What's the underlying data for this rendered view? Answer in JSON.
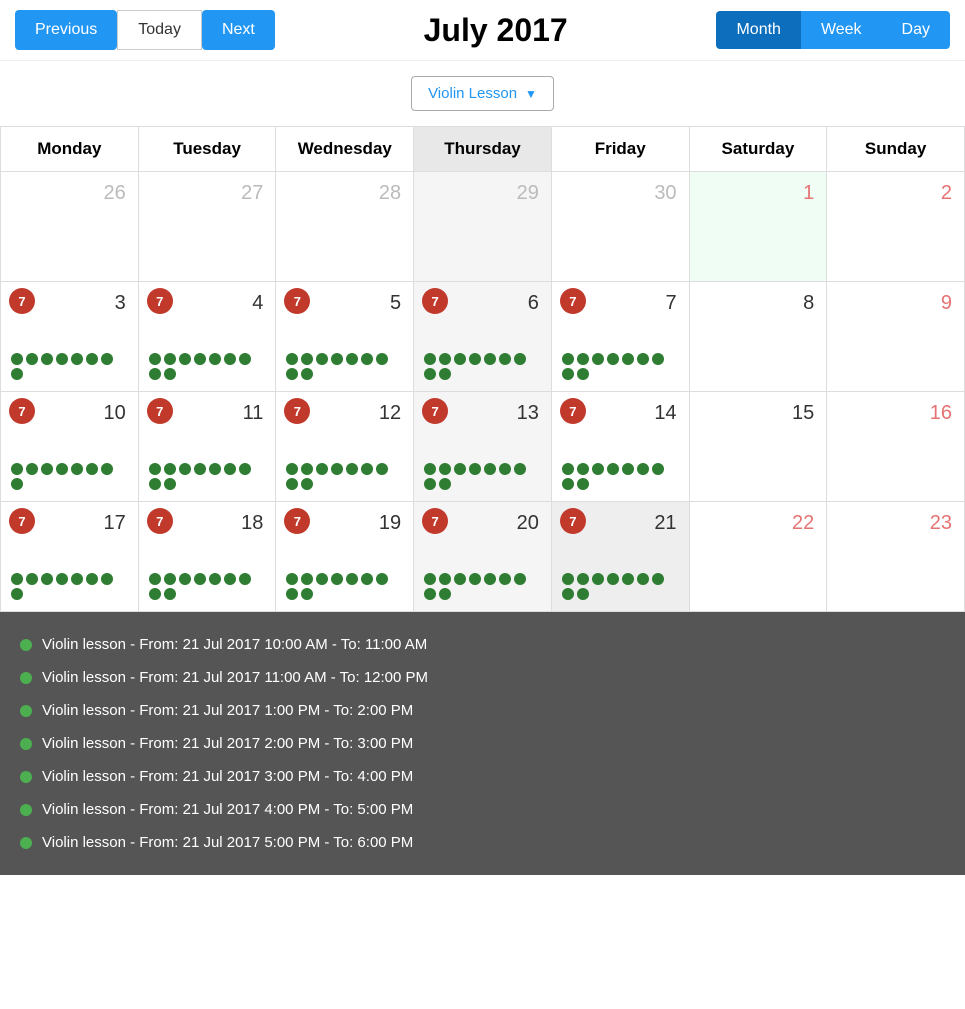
{
  "header": {
    "title": "July 2017",
    "prev_label": "Previous",
    "today_label": "Today",
    "next_label": "Next",
    "view_month": "Month",
    "view_week": "Week",
    "view_day": "Day"
  },
  "filter": {
    "label": "Violin Lesson",
    "arrow": "▼"
  },
  "days_of_week": [
    {
      "label": "Monday",
      "active": false
    },
    {
      "label": "Tuesday",
      "active": false
    },
    {
      "label": "Wednesday",
      "active": false
    },
    {
      "label": "Thursday",
      "active": true
    },
    {
      "label": "Friday",
      "active": false
    },
    {
      "label": "Saturday",
      "active": false
    },
    {
      "label": "Sunday",
      "active": false
    }
  ],
  "weeks": [
    {
      "days": [
        {
          "num": "26",
          "muted": true,
          "badge": null,
          "dots": 0,
          "today": false,
          "weekend": false,
          "selected": false
        },
        {
          "num": "27",
          "muted": true,
          "badge": null,
          "dots": 0,
          "today": false,
          "weekend": false,
          "selected": false
        },
        {
          "num": "28",
          "muted": true,
          "badge": null,
          "dots": 0,
          "today": false,
          "weekend": false,
          "selected": false
        },
        {
          "num": "29",
          "muted": true,
          "badge": null,
          "dots": 0,
          "today": false,
          "weekend": false,
          "selected": false
        },
        {
          "num": "30",
          "muted": true,
          "badge": null,
          "dots": 0,
          "today": false,
          "weekend": false,
          "selected": false
        },
        {
          "num": "1",
          "muted": false,
          "badge": null,
          "dots": 0,
          "today": true,
          "weekend": false,
          "selected": false
        },
        {
          "num": "2",
          "muted": false,
          "badge": null,
          "dots": 0,
          "today": false,
          "weekend": true,
          "selected": false
        }
      ]
    },
    {
      "days": [
        {
          "num": "3",
          "muted": false,
          "badge": "7",
          "dots": 8,
          "today": false,
          "weekend": false,
          "selected": false
        },
        {
          "num": "4",
          "muted": false,
          "badge": "7",
          "dots": 9,
          "today": false,
          "weekend": false,
          "selected": false
        },
        {
          "num": "5",
          "muted": false,
          "badge": "7",
          "dots": 9,
          "today": false,
          "weekend": false,
          "selected": false
        },
        {
          "num": "6",
          "muted": false,
          "badge": "7",
          "dots": 9,
          "today": false,
          "weekend": false,
          "selected": false
        },
        {
          "num": "7",
          "muted": false,
          "badge": "7",
          "dots": 9,
          "today": false,
          "weekend": false,
          "selected": false
        },
        {
          "num": "8",
          "muted": false,
          "badge": null,
          "dots": 0,
          "today": false,
          "weekend": false,
          "selected": false
        },
        {
          "num": "9",
          "muted": false,
          "badge": null,
          "dots": 0,
          "today": false,
          "weekend": true,
          "selected": false
        }
      ]
    },
    {
      "days": [
        {
          "num": "10",
          "muted": false,
          "badge": "7",
          "dots": 8,
          "today": false,
          "weekend": false,
          "selected": false
        },
        {
          "num": "11",
          "muted": false,
          "badge": "7",
          "dots": 9,
          "today": false,
          "weekend": false,
          "selected": false
        },
        {
          "num": "12",
          "muted": false,
          "badge": "7",
          "dots": 9,
          "today": false,
          "weekend": false,
          "selected": false
        },
        {
          "num": "13",
          "muted": false,
          "badge": "7",
          "dots": 9,
          "today": false,
          "weekend": false,
          "selected": false
        },
        {
          "num": "14",
          "muted": false,
          "badge": "7",
          "dots": 9,
          "today": false,
          "weekend": false,
          "selected": false
        },
        {
          "num": "15",
          "muted": false,
          "badge": null,
          "dots": 0,
          "today": false,
          "weekend": false,
          "selected": false
        },
        {
          "num": "16",
          "muted": false,
          "badge": null,
          "dots": 0,
          "today": false,
          "weekend": true,
          "selected": false
        }
      ]
    },
    {
      "days": [
        {
          "num": "17",
          "muted": false,
          "badge": "7",
          "dots": 8,
          "today": false,
          "weekend": false,
          "selected": false
        },
        {
          "num": "18",
          "muted": false,
          "badge": "7",
          "dots": 9,
          "today": false,
          "weekend": false,
          "selected": false
        },
        {
          "num": "19",
          "muted": false,
          "badge": "7",
          "dots": 9,
          "today": false,
          "weekend": false,
          "selected": false
        },
        {
          "num": "20",
          "muted": false,
          "badge": "7",
          "dots": 9,
          "today": false,
          "weekend": false,
          "selected": false
        },
        {
          "num": "21",
          "muted": false,
          "badge": "7",
          "dots": 9,
          "today": false,
          "weekend": false,
          "selected": true
        },
        {
          "num": "22",
          "muted": false,
          "badge": null,
          "dots": 0,
          "today": false,
          "weekend": true,
          "selected": false
        },
        {
          "num": "23",
          "muted": false,
          "badge": null,
          "dots": 0,
          "today": false,
          "weekend": true,
          "selected": false
        }
      ]
    }
  ],
  "events": [
    "Violin lesson - From: 21 Jul 2017 10:00 AM - To: 11:00 AM",
    "Violin lesson - From: 21 Jul 2017 11:00 AM - To: 12:00 PM",
    "Violin lesson - From: 21 Jul 2017 1:00 PM - To: 2:00 PM",
    "Violin lesson - From: 21 Jul 2017 2:00 PM - To: 3:00 PM",
    "Violin lesson - From: 21 Jul 2017 3:00 PM - To: 4:00 PM",
    "Violin lesson - From: 21 Jul 2017 4:00 PM - To: 5:00 PM",
    "Violin lesson - From: 21 Jul 2017 5:00 PM - To: 6:00 PM"
  ]
}
